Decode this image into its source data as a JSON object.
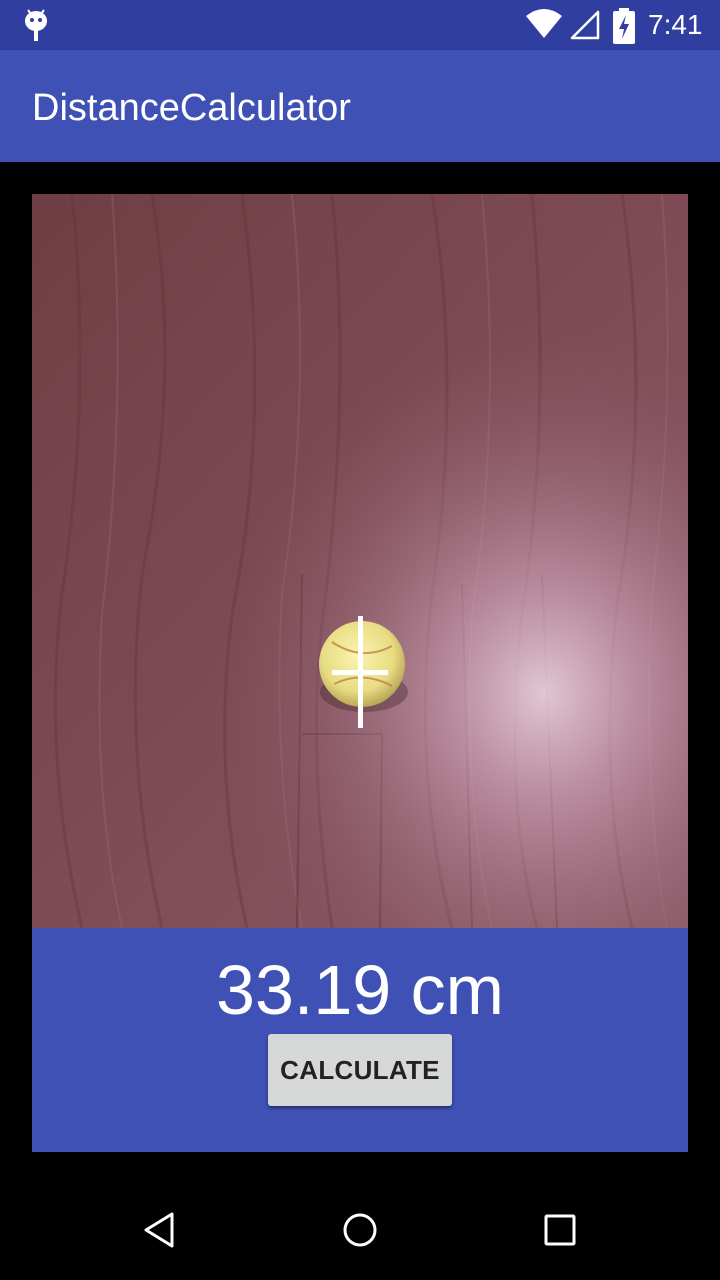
{
  "status_bar": {
    "time": "7:41",
    "icons": [
      "android-debug-icon",
      "wifi-icon",
      "no-signal-icon",
      "battery-charging-icon"
    ]
  },
  "app_bar": {
    "title": "DistanceCalculator"
  },
  "main": {
    "camera_preview": {
      "icon": "crosshair-icon"
    },
    "distance": "33.19 cm",
    "calculate_button": "CALCULATE"
  },
  "nav_bar": {
    "icons": [
      "back-icon",
      "home-icon",
      "recents-icon"
    ]
  },
  "colors": {
    "status_bar": "#303f9f",
    "primary": "#3f51b5",
    "button_bg": "#d6d7d7",
    "background": "#000000"
  }
}
